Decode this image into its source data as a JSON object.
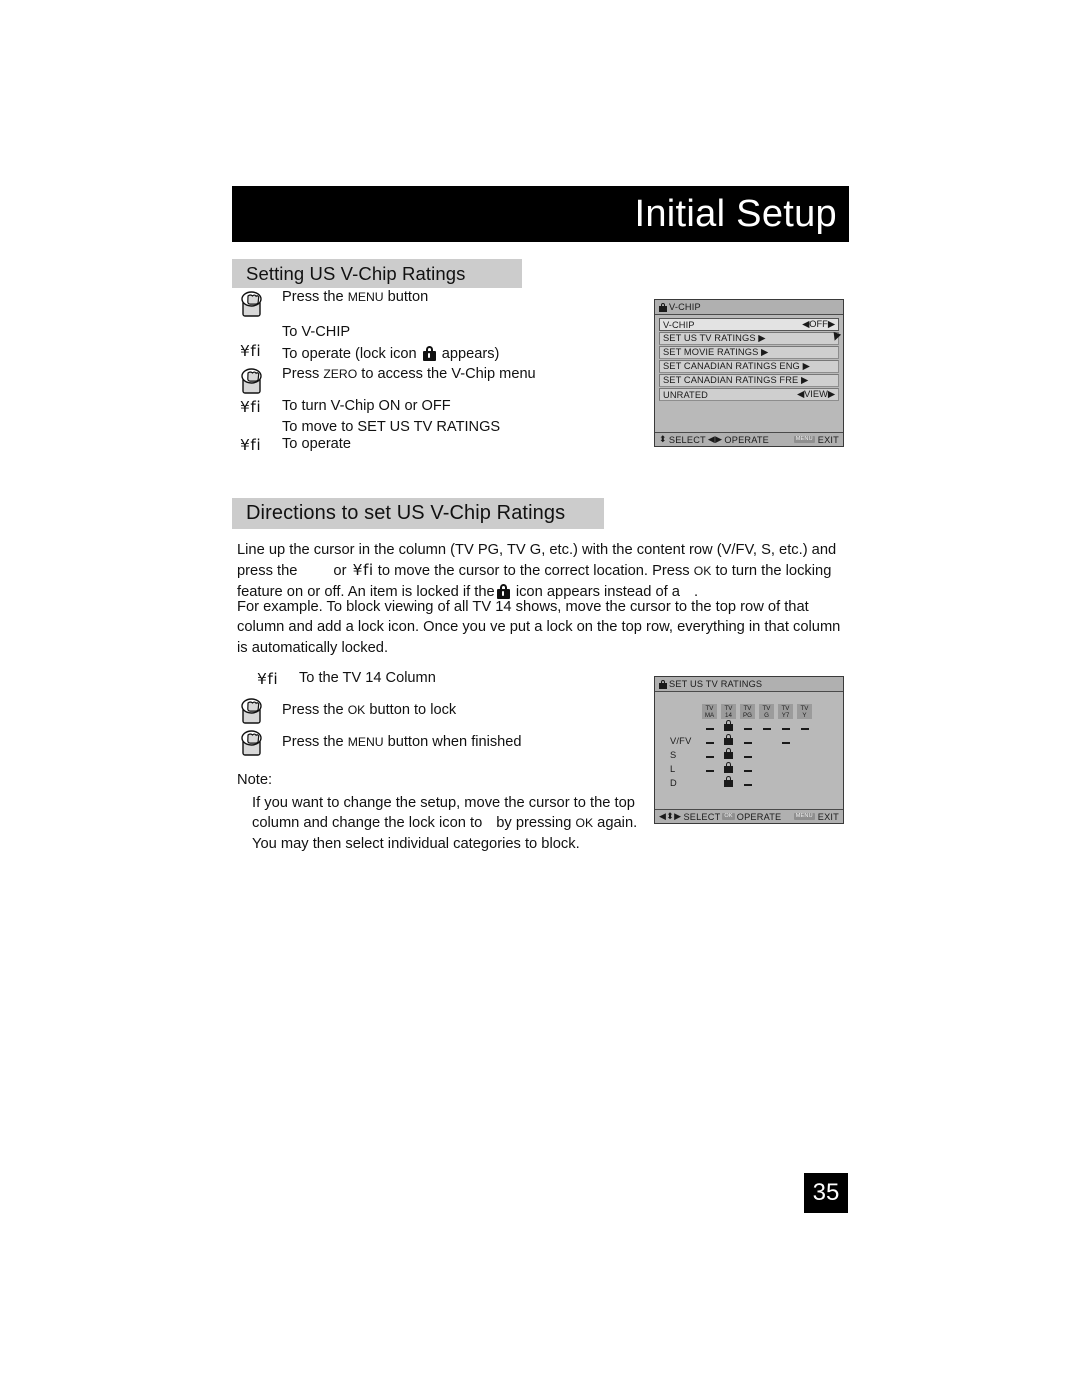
{
  "header": {
    "title": "Initial Setup"
  },
  "page": {
    "number": "35"
  },
  "sections": {
    "setting": {
      "title": "Setting US V-Chip Ratings"
    },
    "directions": {
      "title": "Directions to set US V-Chip Ratings"
    }
  },
  "steps_setting": [
    {
      "icon": "hand-press-button-icon",
      "text": "Press the ",
      "smallcaps": "MENU",
      "text_after": " button"
    },
    {
      "icon": "arrow-glyph",
      "glyph": "¥fi",
      "text_line1": "To V-CHIP",
      "text": "To operate (lock icon ",
      "lock": "lock-icon",
      "text_after": " appears)"
    },
    {
      "icon": "hand-press-button-icon",
      "text": "Press ",
      "smallcaps": "ZERO",
      "text_after": " to access the V-Chip menu"
    },
    {
      "icon": "arrow-glyph",
      "glyph": "¥fi",
      "text": "To turn V-Chip ON or OFF",
      "text_line2": "To move to SET US TV RATINGS"
    },
    {
      "icon": "arrow-glyph",
      "glyph": "¥fi",
      "text": "To operate"
    }
  ],
  "steps_example": [
    {
      "icon": "arrow-glyph",
      "glyph": "¥fi",
      "text": "To the TV 14 Column"
    },
    {
      "icon": "hand-press-button-icon",
      "text": "Press the ",
      "smallcaps": "OK",
      "text_after": " button to lock"
    },
    {
      "icon": "hand-press-button-icon",
      "text": "Press the ",
      "smallcaps": "MENU",
      "text_after": " button when finished"
    }
  ],
  "paragraphs": {
    "directions_p1_a": "Line up the cursor in the column (TV PG, TV G, etc.) with the content row (V/FV, S, etc.) and press the",
    "directions_p1_or": "or",
    "directions_p1_glyph": "¥fi",
    "directions_p1_b": "to move the cursor to the correct location. Press",
    "directions_p1_ok": "OK",
    "directions_p1_c": "to turn the locking feature on or off. An item is locked if the",
    "directions_p1_d": "icon appears instead of a",
    "directions_p1_end": ".",
    "example_p": "For example. To block viewing of all TV 14 shows, move the cursor to the top row of that column and add a lock icon. Once you ve put a lock on the top row, everything in that column is automatically locked.",
    "note_label": "Note:",
    "note_a": "If you want to change the setup, move the cursor to the top column and change the lock icon to",
    "note_b": "by pressing",
    "note_ok": "OK",
    "note_c": "again. You may then select individual categories to block."
  },
  "osd_vchip": {
    "title": "V-CHIP",
    "rows": [
      {
        "label": "V-CHIP",
        "value": "◀OFF▶",
        "selected": true
      },
      {
        "label": "SET US TV RATINGS ▶",
        "value": "",
        "selected": false
      },
      {
        "label": "SET MOVIE RATINGS ▶",
        "value": "",
        "selected": false
      },
      {
        "label": "SET CANADIAN RATINGS ENG ▶",
        "value": "",
        "selected": false
      },
      {
        "label": "SET CANADIAN RATINGS FRE ▶",
        "value": "",
        "selected": false
      },
      {
        "label": "UNRATED",
        "value": "◀VIEW▶",
        "selected": false
      }
    ],
    "footer": {
      "select_arrows": "⬍",
      "select": "SELECT",
      "operate_arrows": "◀▶",
      "operate": "OPERATE",
      "exit_key": "MENU",
      "exit": "EXIT"
    }
  },
  "osd_ratings": {
    "title": "SET US TV RATINGS",
    "columns": [
      {
        "line1": "TV",
        "line2": "MA"
      },
      {
        "line1": "TV",
        "line2": "14"
      },
      {
        "line1": "TV",
        "line2": "PG"
      },
      {
        "line1": "TV",
        "line2": "G"
      },
      {
        "line1": "TV",
        "line2": "Y7"
      },
      {
        "line1": "TV",
        "line2": "Y"
      }
    ],
    "rows": [
      {
        "label": "",
        "cells": [
          "dash",
          "lock",
          "dash",
          "dash",
          "dash",
          "dash"
        ]
      },
      {
        "label": "V/FV",
        "cells": [
          "dash",
          "lock",
          "dash",
          "",
          "dash",
          ""
        ]
      },
      {
        "label": "S",
        "cells": [
          "dash",
          "lock",
          "dash",
          "",
          "",
          ""
        ]
      },
      {
        "label": "L",
        "cells": [
          "dash",
          "lock",
          "dash",
          "",
          "",
          ""
        ]
      },
      {
        "label": "D",
        "cells": [
          "",
          "lock",
          "dash",
          "",
          "",
          ""
        ]
      }
    ],
    "footer": {
      "select_arrows": "◀⬍▶",
      "select": "SELECT",
      "operate_key": "OK",
      "operate": "OPERATE",
      "exit_key": "MENU",
      "exit": "EXIT"
    }
  },
  "colors": {
    "header_bg": "#000000",
    "section_bg": "#cccccc",
    "osd_bg": "#b9b9b9",
    "osd_row": "#cfcfcf",
    "osd_row_selected": "#e3e3e3"
  }
}
